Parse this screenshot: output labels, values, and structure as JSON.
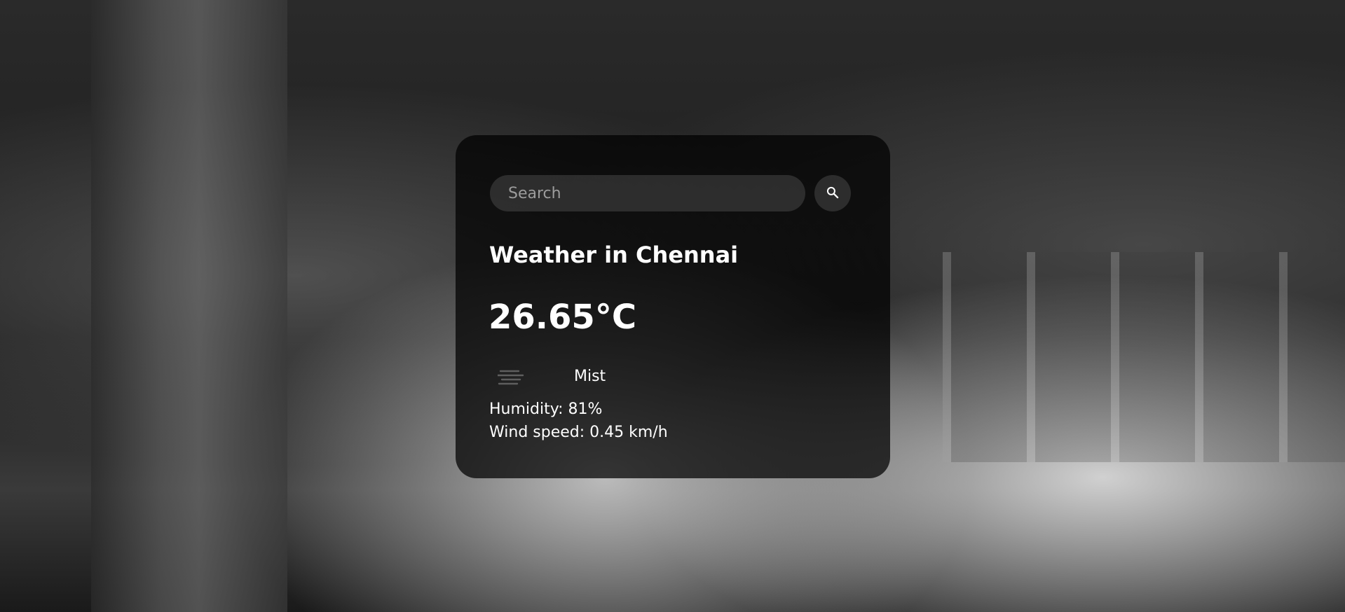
{
  "search": {
    "placeholder": "Search",
    "value": ""
  },
  "weather": {
    "city_label": "Weather in Chennai",
    "temperature": "26.65°C",
    "icon": "mist-icon",
    "description": "Mist",
    "humidity": "Humidity: 81%",
    "wind_speed": "Wind speed: 0.45 km/h"
  },
  "colors": {
    "card_background": "#000000",
    "text": "#ffffff",
    "input_background": "#7c7c7c"
  }
}
